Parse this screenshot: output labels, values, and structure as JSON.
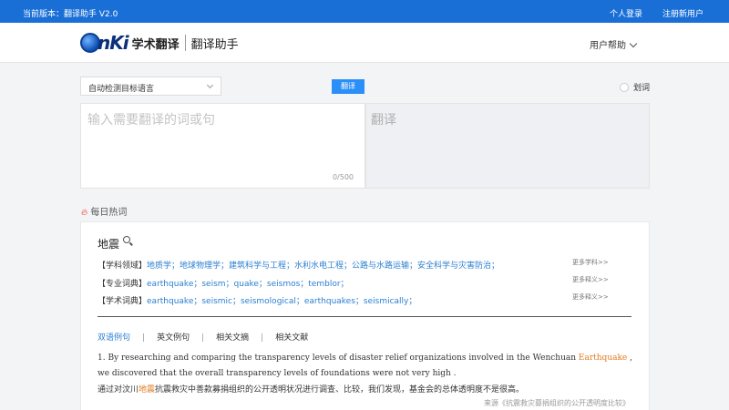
{
  "topbar": {
    "version": "当前版本：翻译助手 V2.0",
    "login": "个人登录",
    "register": "注册新用户"
  },
  "header": {
    "brand_cn": "学术翻译",
    "app_name": "翻译助手",
    "help": "用户帮助"
  },
  "translator": {
    "language_select": "自动检测目标语言",
    "translate_button": "翻译",
    "huaci": "划词",
    "input_placeholder": "输入需要翻译的词或句",
    "char_count": "0/500",
    "output_placeholder": "翻译"
  },
  "hot": {
    "title": "每日热词"
  },
  "card": {
    "word": "地震",
    "rows": [
      {
        "label": "【学科领域】",
        "items": "地质学；地球物理学；建筑科学与工程；水利水电工程；公路与水路运输；安全科学与灾害防治；",
        "more": "更多学科>>"
      },
      {
        "label": "【专业词典】",
        "items": "earthquake；seism；quake；seismos；temblor；",
        "more": "更多释义>>"
      },
      {
        "label": "【学术词典】",
        "items": "earthquake；seismic；seismological；earthquakes；seismically；",
        "more": "更多释义>>"
      }
    ],
    "tabs": [
      "双语例句",
      "英文例句",
      "相关文摘",
      "相关文献"
    ],
    "tab_separator": "|",
    "example": {
      "en_before": "1. By researching and comparing the transparency levels of disaster relief organizations involved in the Wenchuan ",
      "en_highlight": "Earthquake",
      "en_after": " , we discovered that the overall transparency levels of foundations were not very high .",
      "cn_before": "通过对汶川",
      "cn_highlight": "地震",
      "cn_after": "抗震救灾中善款募捐组织的公开透明状况进行调查、比较，我们发现，基金会的总体透明度不是很高。",
      "source": "来源《抗震救灾募捐组织的公开透明度比较》"
    }
  },
  "colors": {
    "topbar": "#1a6fd7",
    "button": "#2a8ff7",
    "link": "#2a7fd0",
    "highlight": "#e07b20",
    "fire": "#e8452c"
  }
}
